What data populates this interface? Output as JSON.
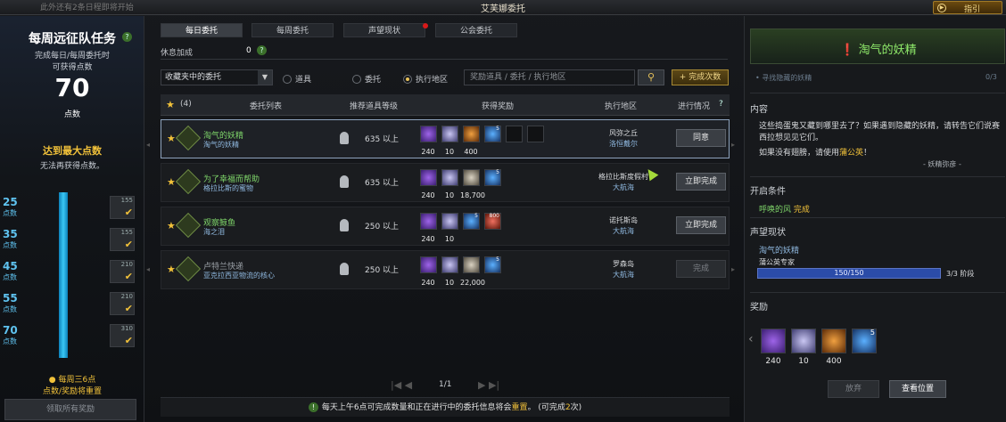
{
  "window": {
    "notice": "此外还有2条日程即将开始",
    "title": "艾芙娜委托",
    "guide_label": "指引"
  },
  "left": {
    "title": "每周远征队任务",
    "desc_line1": "完成每日/每周委托时",
    "desc_line2": "可获得点数",
    "points": "70",
    "points_unit": "点数",
    "max_title": "达到最大点数",
    "max_sub": "无法再获得点数。",
    "tiers": [
      {
        "value": "25",
        "unit": "点数",
        "item_count": "155"
      },
      {
        "value": "35",
        "unit": "点数",
        "item_count": "155"
      },
      {
        "value": "45",
        "unit": "点数",
        "item_count": "210"
      },
      {
        "value": "55",
        "unit": "点数",
        "item_count": "210"
      },
      {
        "value": "70",
        "unit": "点数",
        "item_count": "310"
      }
    ],
    "warn_line1": "每周三6点",
    "warn_line2": "点数/奖励将重置",
    "claim_all": "领取所有奖励"
  },
  "tabs": [
    "每日委托",
    "每周委托",
    "声望现状",
    "公会委托"
  ],
  "rest": {
    "label": "休息加成",
    "value": "0"
  },
  "filter": {
    "select_value": "收藏夹中的委托",
    "radios": [
      "道具",
      "委托",
      "执行地区"
    ],
    "radio_selected": "执行地区",
    "search_placeholder": "奖励道具 / 委托 / 执行地区",
    "add_button": "+ 完成次数"
  },
  "table": {
    "fav_count": "(4)",
    "headers": [
      "委托列表",
      "推荐道具等级",
      "获得奖励",
      "执行地区",
      "进行情况"
    ],
    "rows": [
      {
        "name": "淘气的妖精",
        "sub": "淘气的妖精",
        "level": "635 以上",
        "loc1": "风弥之丘",
        "loc2": "洛恒戴尔",
        "action": "同意",
        "rewards": [
          {
            "kind": "p",
            "n": "240"
          },
          {
            "kind": "d",
            "n": "10"
          },
          {
            "kind": "o",
            "n": "400"
          },
          {
            "kind": "b",
            "n": "",
            "c": "5"
          },
          {
            "kind": "e",
            "n": ""
          },
          {
            "kind": "e",
            "n": ""
          }
        ]
      },
      {
        "name": "为了幸福而帮助",
        "sub": "格拉比斯的蜜物",
        "level": "635 以上",
        "loc1": "格拉比斯度假村",
        "loc2": "大航海",
        "action": "立即完成",
        "rewards": [
          {
            "kind": "p",
            "n": "240"
          },
          {
            "kind": "d",
            "n": "10"
          },
          {
            "kind": "g",
            "n": "18,700"
          },
          {
            "kind": "b",
            "n": "",
            "c": "5"
          }
        ]
      },
      {
        "name": "观察鲸鱼",
        "sub": "海之泪",
        "level": "250 以上",
        "loc1": "诺托斯岛",
        "loc2": "大航海",
        "action": "立即完成",
        "rewards": [
          {
            "kind": "p",
            "n": "240"
          },
          {
            "kind": "d",
            "n": "10"
          },
          {
            "kind": "b",
            "n": "",
            "c": "5"
          },
          {
            "kind": "r",
            "n": "",
            "c": "800"
          }
        ]
      },
      {
        "name": "卢特兰快递",
        "sub": "亚克拉西亚物流的核心",
        "level": "250 以上",
        "loc1": "罗森岛",
        "loc2": "大航海",
        "action": "完成",
        "rewards": [
          {
            "kind": "p",
            "n": "240"
          },
          {
            "kind": "d",
            "n": "10"
          },
          {
            "kind": "g",
            "n": "22,000"
          },
          {
            "kind": "b",
            "n": "",
            "c": "5"
          }
        ]
      }
    ]
  },
  "pager": "1/1",
  "bottom_note": {
    "pre": "每天上午6点可完成数量和正在进行中的委托信息将会",
    "hl": "重置",
    "post": "。 (可完成",
    "count": "2",
    "end": "次)"
  },
  "right": {
    "title": "淘气的妖精",
    "cut_text": "• 寻找隐藏的妖精",
    "cut_count": "0/3",
    "content_label": "内容",
    "content_text": "这些捣蛋鬼又藏到哪里去了？如果遇到隐藏的妖精，请转告它们说赛西拉想见见它们。",
    "content_use_pre": "如果没有翅膀，请使用",
    "content_use_hl": "蒲公英",
    "content_use_post": "！",
    "signature": "- 妖精弥彦 -",
    "cond_label": "开启条件",
    "cond_text": "呼唤的风",
    "cond_status": "完成",
    "rep_label": "声望现状",
    "rep_name": "淘气的妖精",
    "rep_title": "蒲公英专家",
    "rep_bar_text": "150/150",
    "rep_fill": 1.0,
    "rep_stage": "3/3 阶段",
    "reward_label": "奖励",
    "rewards": [
      {
        "kind": "p",
        "n": "240"
      },
      {
        "kind": "d",
        "n": "10"
      },
      {
        "kind": "o",
        "n": "400"
      },
      {
        "kind": "b",
        "n": "",
        "c": "5"
      }
    ],
    "abandon": "放弃",
    "view_location": "查看位置"
  }
}
